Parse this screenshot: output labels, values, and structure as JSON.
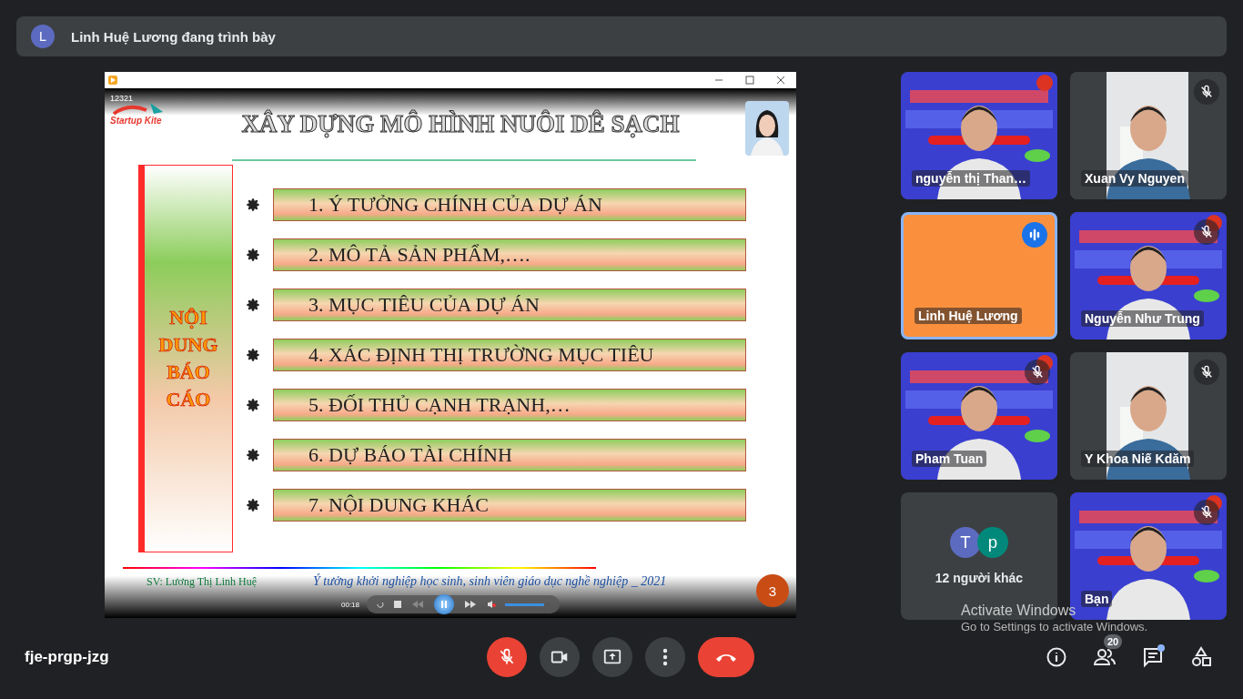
{
  "presenter_bar": {
    "avatar_letter": "L",
    "text": "Linh Huệ Lương đang trình bày"
  },
  "presentation": {
    "slide": {
      "counter": "12321",
      "logo_text": "Startup Kite",
      "title": "XÂY DỰNG MÔ HÌNH NUÔI DÊ SẠCH",
      "side_label": "NỘI DUNG BÁO CÁO",
      "items": [
        "1. Ý TƯỞNG CHÍNH CỦA DỰ ÁN",
        "2. MÔ TẢ SẢN PHẨM,….",
        "3. MỤC TIÊU CỦA DỰ ÁN",
        "4. XÁC ĐỊNH THỊ TRƯỜNG MỤC TIÊU",
        "5. ĐỐI THỦ CẠNH TRẠNH,…",
        "6. DỰ BÁO TÀI CHÍNH",
        "7. NỘI DUNG KHÁC"
      ],
      "author": "SV: Lương Thị Linh Huệ",
      "footer": "Ý tưởng khởi nghiệp học sinh, sinh viên giáo dục nghề nghiệp _ 2021",
      "page_number": "3"
    },
    "player": {
      "time": "00:18",
      "playing": true,
      "volume": {
        "level": 0.85
      }
    }
  },
  "tiles": [
    {
      "kind": "video",
      "name": "nguyễn thị Than…",
      "muted": false,
      "speaking": false
    },
    {
      "kind": "video",
      "name": "Xuan Vy Nguyen",
      "muted": true,
      "speaking": false
    },
    {
      "kind": "avatar",
      "name": "Linh Huệ Lương",
      "muted": false,
      "speaking": true,
      "color": "#fa903e"
    },
    {
      "kind": "video",
      "name": "Nguyễn Như Trung",
      "muted": true,
      "speaking": false
    },
    {
      "kind": "video",
      "name": "Pham Tuan",
      "muted": true,
      "speaking": false
    },
    {
      "kind": "video",
      "name": "Y Khoa Niế Kdăm",
      "muted": true,
      "speaking": false
    },
    {
      "kind": "others",
      "name": "12 người khác",
      "avatars": [
        {
          "letter": "T",
          "color": "#5c6bc0"
        },
        {
          "letter": "p",
          "color": "#00897b"
        }
      ]
    },
    {
      "kind": "video",
      "name": "Bạn",
      "muted": true,
      "speaking": false
    }
  ],
  "os_notice": {
    "title": "Activate Windows",
    "subtitle": "Go to Settings to activate Windows."
  },
  "bottom_bar": {
    "meeting_code": "fje-prgp-jzg",
    "mic_muted": true,
    "people_count": "20",
    "chat_unread": true
  }
}
